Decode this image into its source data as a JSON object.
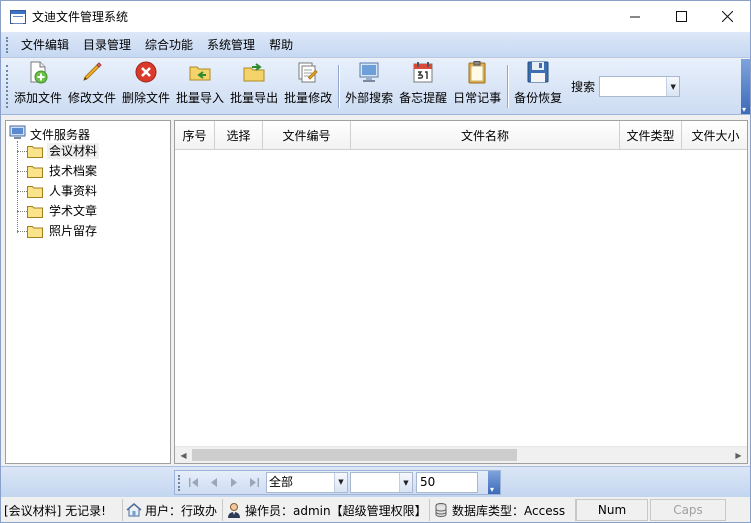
{
  "window": {
    "title": "文迪文件管理系统",
    "controls": [
      "minimize",
      "maximize",
      "close"
    ]
  },
  "menu": {
    "items": [
      "文件编辑",
      "目录管理",
      "综合功能",
      "系统管理",
      "帮助"
    ]
  },
  "toolbar": {
    "buttons": [
      {
        "label": "添加文件",
        "icon": "add-file-icon"
      },
      {
        "label": "修改文件",
        "icon": "pencil-icon"
      },
      {
        "label": "删除文件",
        "icon": "delete-icon"
      },
      {
        "label": "批量导入",
        "icon": "folder-import-icon"
      },
      {
        "label": "批量导出",
        "icon": "folder-export-icon"
      },
      {
        "label": "批量修改",
        "icon": "batch-edit-icon"
      },
      {
        "label": "外部搜索",
        "icon": "external-search-icon"
      },
      {
        "label": "备忘提醒",
        "icon": "calendar-icon"
      },
      {
        "label": "日常记事",
        "icon": "clipboard-icon"
      },
      {
        "label": "备份恢复",
        "icon": "floppy-disk-icon"
      }
    ],
    "search_label": "搜索",
    "search_value": ""
  },
  "tree": {
    "root": "文件服务器",
    "items": [
      "会议材料",
      "技术档案",
      "人事资料",
      "学术文章",
      "照片留存"
    ],
    "selected": "会议材料"
  },
  "grid": {
    "columns": [
      "序号",
      "选择",
      "文件编号",
      "文件名称",
      "文件类型",
      "文件大小"
    ],
    "rows": []
  },
  "pager": {
    "filter_value": "全部",
    "second_value": "",
    "page_size": "50"
  },
  "status": {
    "message": "[会议材料] 无记录!",
    "user": "用户：行政办",
    "operator": "操作员：admin【超级管理权限】",
    "db_type": "数据库类型：Access",
    "num": "Num",
    "caps": "Caps"
  },
  "colors": {
    "toolbar_top": "#e8f0fb",
    "toolbar_bottom": "#cddcf3",
    "accent_blue": "#3d6ab8",
    "delete_red": "#d93a2b"
  }
}
